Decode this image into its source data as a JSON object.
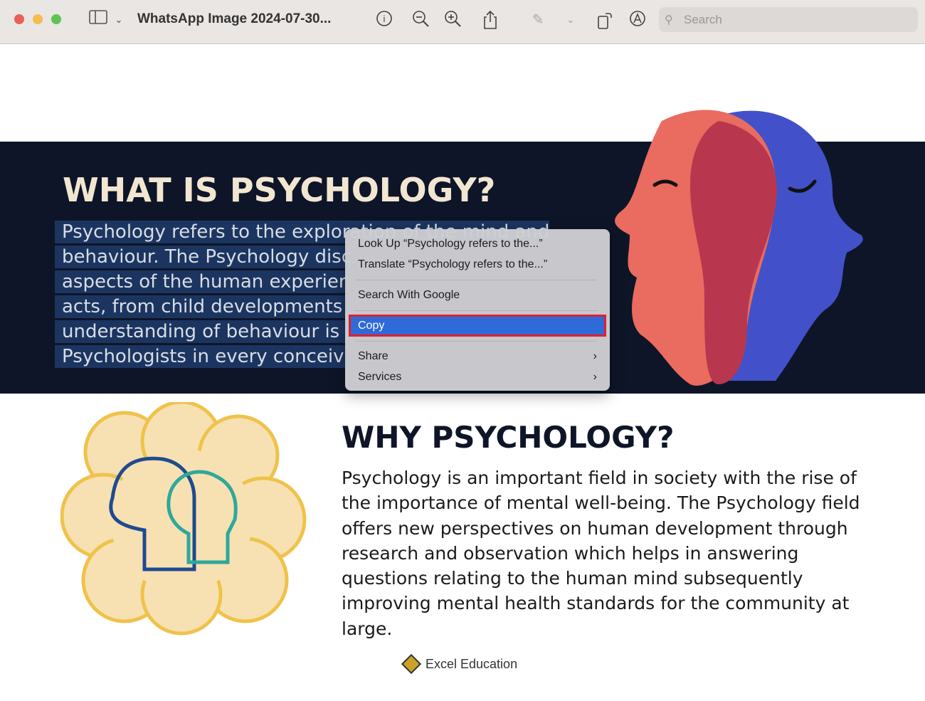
{
  "window": {
    "title": "WhatsApp Image 2024-07-30...",
    "search_placeholder": "Search"
  },
  "toolbar": {
    "icons": [
      "sidebar-icon",
      "chevron-down-icon",
      "info-icon",
      "zoom-out-icon",
      "zoom-in-icon",
      "share-icon",
      "markup-pen-icon",
      "chevron-down-icon",
      "rotate-icon",
      "markup-icon"
    ]
  },
  "document": {
    "heading1": "WHAT IS PSYCHOLOGY?",
    "selected_lines": [
      "Psychology refers to the exploration of the mind and",
      "behaviour. The Psychology disc",
      "aspects of the human experier",
      "acts, from child developments",
      "understanding of behaviour is",
      "Psychologists in every conceiv"
    ],
    "heading2": "WHY PSYCHOLOGY?",
    "paragraph": "Psychology is an important field in society with the rise of the importance of mental well-being. The Psychology field offers new perspectives on human development through research and observation which helps in answering questions relating to the human mind subsequently improving mental health standards for the community at large.",
    "logo_text": "Excel Education"
  },
  "context_menu": {
    "look_up": "Look Up “Psychology refers to the...”",
    "translate": "Translate “Psychology refers to the...”",
    "search_google": "Search With Google",
    "copy": "Copy",
    "share": "Share",
    "services": "Services",
    "highlight_color": "#2f6ad9",
    "outline_color": "#e0202a"
  }
}
